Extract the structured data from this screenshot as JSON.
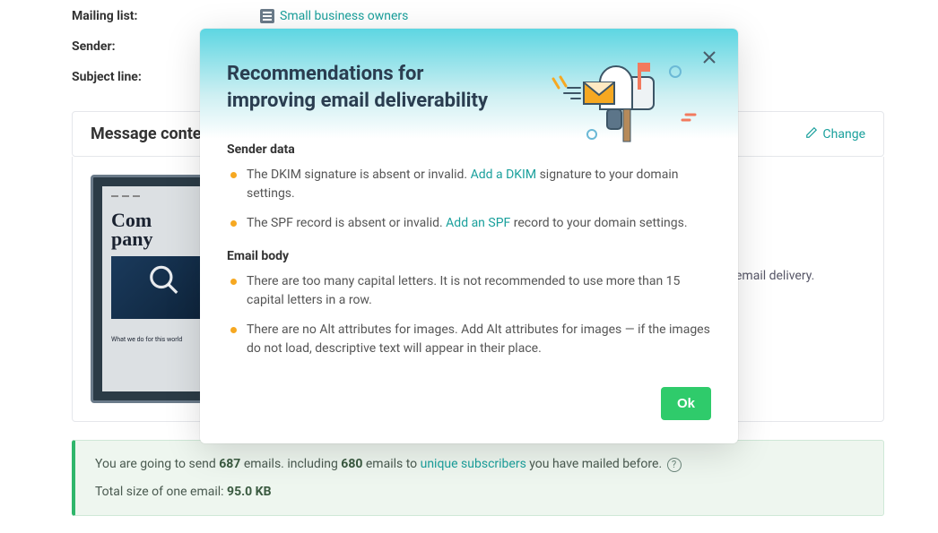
{
  "fields": {
    "mailing_list_label": "Mailing list:",
    "mailing_list_value": "Small business owners",
    "sender_label": "Sender:",
    "subject_label": "Subject line:"
  },
  "section": {
    "title": "Message content",
    "change_label": "Change"
  },
  "thumbnail": {
    "title_line1": "Com",
    "title_line2": "pany",
    "footer": "What we do for this world"
  },
  "right_tip_tail": "email delivery.",
  "summary": {
    "pre": "You are going to send ",
    "emails_count": "687",
    "mid1": " emails.  including ",
    "sub_count": "680",
    "mid2": " emails to ",
    "unique_link": "unique subscribers",
    "tail": " you have mailed before. ",
    "size_label": "Total size of one email: ",
    "size_value": "95.0 KB"
  },
  "modal": {
    "title": "Recommendations for improving email deliverability",
    "sender_heading": "Sender data",
    "body_heading": "Email body",
    "items": {
      "dkim_pre": "The DKIM signature is absent or invalid. ",
      "dkim_link": "Add a DKIM",
      "dkim_post": " signature to your domain settings.",
      "spf_pre": "The SPF record is absent or invalid. ",
      "spf_link": "Add an SPF",
      "spf_post": " record to your domain settings.",
      "caps": "There are too many capital letters. It is not recommended to use more than 15 capital letters in a row.",
      "alt": "There are no Alt attributes for images. Add Alt attributes for images — if the images do not load, descriptive text will appear in their place."
    },
    "ok_label": "Ok"
  }
}
